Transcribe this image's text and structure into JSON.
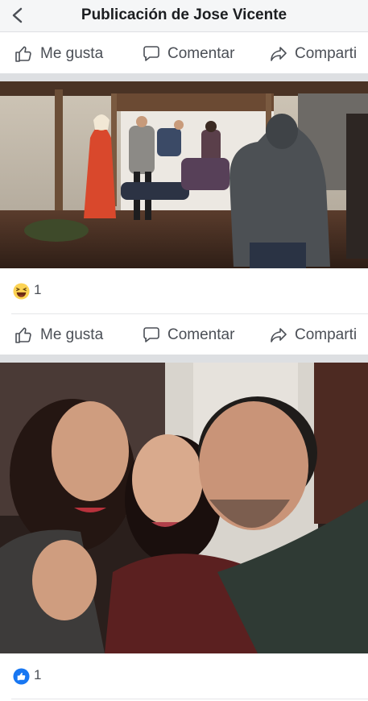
{
  "header": {
    "title": "Publicación de Jose Vicente",
    "back_icon": "chevron-left-icon"
  },
  "actions": {
    "like": "Me gusta",
    "comment": "Comentar",
    "share": "Comparti"
  },
  "posts": [
    {
      "photo_description_icon": "nativity-scene-photo",
      "reaction_icon": "haha-reaction-icon",
      "reaction_count": "1"
    },
    {
      "photo_description_icon": "selfie-photo",
      "reaction_icon": "like-reaction-icon",
      "reaction_count": "1"
    }
  ],
  "colors": {
    "accent": "#1877f2",
    "header_bg": "#f5f6f7",
    "text_muted": "#4b4f56",
    "divider": "#dddfe2",
    "haha_yellow": "#fcd354"
  }
}
